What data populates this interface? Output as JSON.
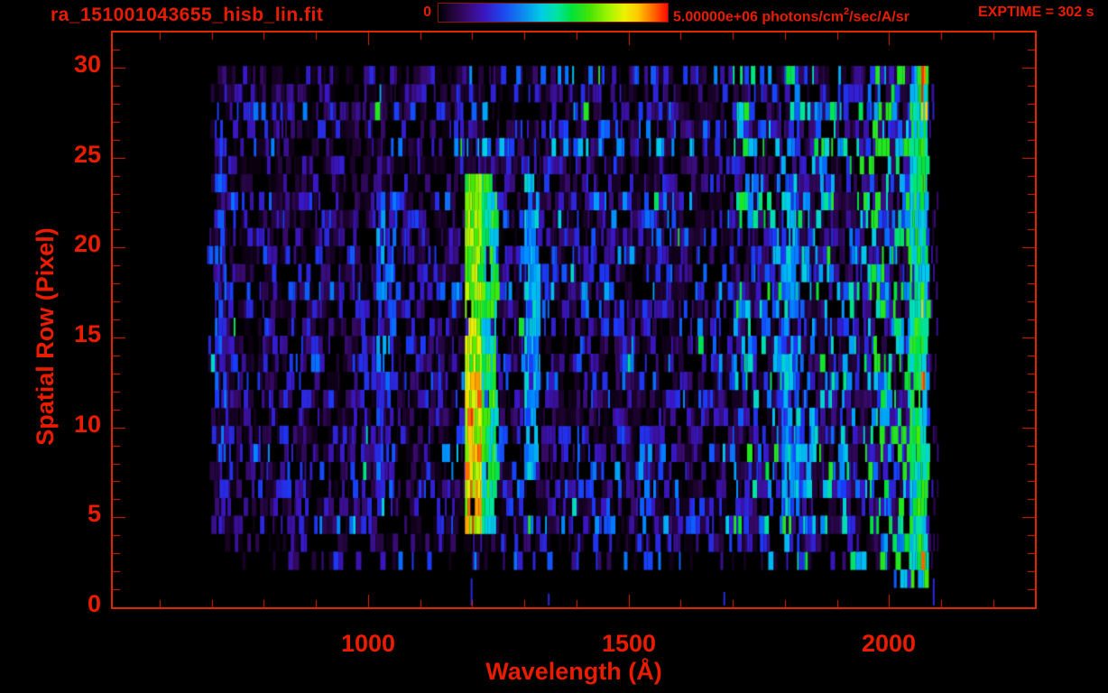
{
  "window": {
    "background": "#000000",
    "accent_red": "#ea1c00",
    "line_red": "#e02800"
  },
  "header": {
    "title": "ra_151001043655_hisb_lin.fit",
    "colorbar": {
      "min_label": "0",
      "max_prefix": "5.00000e+06 photons/cm",
      "max_sup": "2",
      "max_suffix": "/sec/A/sr"
    },
    "exptime": "EXPTIME = 302 s"
  },
  "axes": {
    "x": {
      "title": "Wavelength (Å)",
      "tick_labels": [
        "1000",
        "1500",
        "2000"
      ]
    },
    "y": {
      "title": "Spatial Row (Pixel)",
      "tick_labels": [
        "0",
        "5",
        "10",
        "15",
        "20",
        "25",
        "30"
      ]
    }
  },
  "chart_data": {
    "type": "heatmap",
    "title": "ra_151001043655_hisb_lin.fit",
    "xlabel": "Wavelength (Å)",
    "ylabel": "Spatial Row (Pixel)",
    "xlim": [
      510,
      2280
    ],
    "ylim": [
      0,
      31.9
    ],
    "x_major_ticks": [
      1000,
      1500,
      2000
    ],
    "x_minor_tick_step": 100,
    "y_major_ticks": [
      0,
      5,
      10,
      15,
      20,
      25,
      30
    ],
    "y_minor_tick_step": 1,
    "grid": false,
    "legend_position": "none",
    "colorbar": {
      "min": 0,
      "max": 5000000,
      "min_label": "0",
      "max_label": "5.00000e+06 photons/cm2/sec/A/sr",
      "palette": "rainbow"
    },
    "exposure_time_s": 302,
    "description": "2D FUV spectral image: photon flux vs wavelength (~690-2075 A) and spatial row (1-30). Dim blue/purple background noise, bright green-yellow Lyman-alpha emission stripe near 1200 A spanning rows 5-24, faint blue column near 1030 A, cyan column near 1810 A, and a bright green band with red-saturated pixels at the 2040-2075 A detector edge.",
    "render": {
      "seed": 1151,
      "rows": 30,
      "row_height": 19.93,
      "data_lambda": [
        694,
        2072
      ],
      "row_start_jitter": 36,
      "noise_bands": [
        [
          690,
          1160,
          0.085,
          0.34
        ],
        [
          1160,
          1345,
          0.105,
          0.3
        ],
        [
          1345,
          1700,
          0.105,
          0.28
        ],
        [
          1700,
          1960,
          0.16,
          0.22
        ],
        [
          1960,
          2040,
          0.24,
          0.16
        ],
        [
          2040,
          2074,
          0.3,
          0.12
        ]
      ],
      "features": [
        {
          "name": "lyman-alpha-core",
          "l": [
            1186,
            1218
          ],
          "rows": [
            5,
            24
          ],
          "v": [
            0.58,
            0.82
          ],
          "hot_rows": [
            5,
            13
          ],
          "v_hot": [
            0.68,
            0.97
          ],
          "gap": 0.03
        },
        {
          "name": "lyman-alpha-wing",
          "l": [
            1218,
            1244
          ],
          "rows": [
            5,
            24
          ],
          "v": [
            0.42,
            0.7
          ],
          "gap": 0.08
        },
        {
          "name": "lyman-beta-column",
          "l": [
            1016,
            1048
          ],
          "rows": [
            7,
            23
          ],
          "v": [
            0.16,
            0.42
          ],
          "gap": 0.3
        },
        {
          "name": "companion-line",
          "l": [
            1300,
            1324
          ],
          "rows": [
            8,
            24
          ],
          "v": [
            0.28,
            0.5
          ],
          "gap": 0.14
        },
        {
          "name": "left-edge-column",
          "l": [
            706,
            724
          ],
          "rows": [
            5,
            27
          ],
          "v": [
            0.15,
            0.36
          ],
          "gap": 0.45
        },
        {
          "name": "cyan-1800-column",
          "l": [
            1794,
            1826
          ],
          "rows": [
            6,
            24
          ],
          "v": [
            0.26,
            0.5
          ],
          "gap": 0.25
        },
        {
          "name": "right-green-edge",
          "l": [
            2040,
            2070
          ],
          "rows": [
            2,
            30
          ],
          "v": [
            0.4,
            0.66
          ],
          "gap": 0.08
        },
        {
          "name": "row2-cluster",
          "l": [
            1992,
            2042
          ],
          "rows": [
            2,
            2
          ],
          "v": [
            0.2,
            0.45
          ],
          "gap": 0.35
        },
        {
          "name": "hot-right-specks",
          "l": [
            2062,
            2078
          ],
          "rows_list": [
            3,
            8,
            13,
            17,
            28,
            29,
            30
          ],
          "v": [
            0.82,
            1.0
          ],
          "gap": 0.55
        }
      ],
      "row1_specks": [
        {
          "l": 1197,
          "h": 30
        },
        {
          "l": 1345,
          "h": 13
        },
        {
          "l": 1682,
          "h": 15
        },
        {
          "l": 2084,
          "h": 30
        }
      ],
      "right_tail": {
        "l": [
          2074,
          2092
        ],
        "rows": [
          3,
          30
        ],
        "per_row_max": 2,
        "v": [
          0.06,
          0.22
        ]
      },
      "colormap": [
        [
          0.0,
          0,
          0,
          0
        ],
        [
          0.05,
          25,
          2,
          40
        ],
        [
          0.12,
          55,
          10,
          105
        ],
        [
          0.2,
          58,
          22,
          195
        ],
        [
          0.28,
          25,
          60,
          250
        ],
        [
          0.37,
          0,
          140,
          255
        ],
        [
          0.45,
          0,
          205,
          235
        ],
        [
          0.52,
          0,
          228,
          160
        ],
        [
          0.58,
          0,
          225,
          60
        ],
        [
          0.66,
          70,
          235,
          5
        ],
        [
          0.74,
          160,
          245,
          0
        ],
        [
          0.81,
          235,
          242,
          0
        ],
        [
          0.87,
          255,
          200,
          0
        ],
        [
          0.93,
          255,
          115,
          0
        ],
        [
          1.0,
          255,
          10,
          0
        ]
      ]
    }
  }
}
